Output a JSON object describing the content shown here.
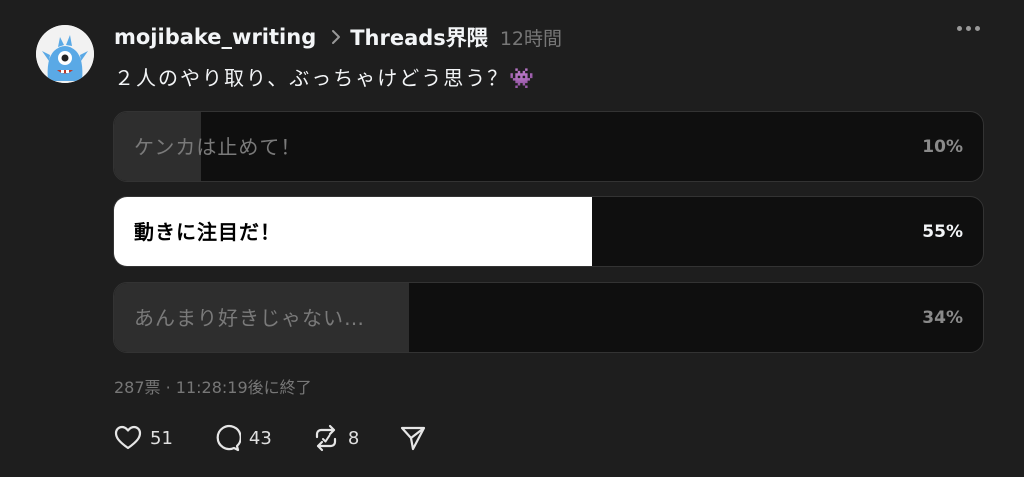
{
  "post": {
    "username": "mojibake_writing",
    "community": "Threads界隈",
    "time": "12時間",
    "question": "２人のやり取り、ぶっちゃけどう思う？👾"
  },
  "poll": {
    "options": [
      {
        "label": "ケンカは止めて！",
        "percent_text": "10%",
        "percent": 10,
        "selected": false
      },
      {
        "label": "動きに注目だ！",
        "percent_text": "55%",
        "percent": 55,
        "selected": true
      },
      {
        "label": "あんまり好きじゃない…",
        "percent_text": "34%",
        "percent": 34,
        "selected": false
      }
    ],
    "meta": "287票 · 11:28:19後に終了"
  },
  "actions": {
    "likes": "51",
    "comments": "43",
    "reposts": "8"
  },
  "colors": {
    "background": "#1e1e1e",
    "selected_fill": "#ffffff",
    "unselected_fill": "#2e2e2e",
    "muted_text": "#777777"
  },
  "icons": [
    "avatar-monster",
    "chevron-right-icon",
    "more-icon",
    "heart-icon",
    "comment-icon",
    "repost-icon",
    "share-icon"
  ]
}
